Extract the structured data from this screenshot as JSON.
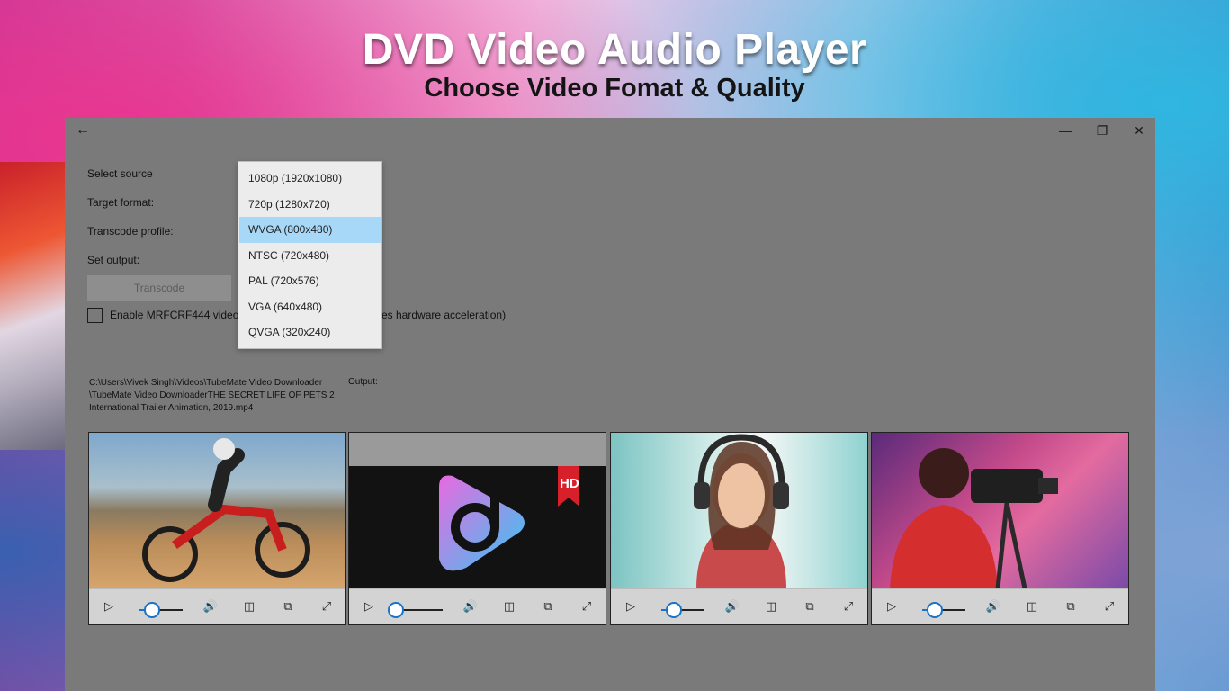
{
  "promo": {
    "title": "DVD Video Audio Player",
    "subtitle": "Choose Video Fomat & Quality"
  },
  "window": {
    "back_icon": "←",
    "minimize_icon": "—",
    "restore_icon": "❐",
    "close_icon": "✕"
  },
  "form": {
    "select_source_label": "Select source",
    "target_format_label": "Target format:",
    "transcode_profile_label": "Transcode profile:",
    "set_output_label": "Set output:",
    "transcode_button": "Transcode",
    "checkbox_label_start": "Enable MRFCRF444 video",
    "checkbox_label_end": "es hardware acceleration)",
    "source_path_line1": "C:\\Users\\Vivek Singh\\Videos\\TubeMate Video Downloader",
    "source_path_line2": "\\TubeMate Video DownloaderTHE SECRET LIFE OF PETS 2",
    "source_path_line3": "International Trailer Animation, 2019.mp4",
    "output_label": "Output:"
  },
  "dropdown": {
    "selected_index": 2,
    "options": [
      "1080p (1920x1080)",
      "720p (1280x720)",
      "WVGA (800x480)",
      "NTSC (720x480)",
      "PAL (720x576)",
      "VGA (640x480)",
      "QVGA (320x240)"
    ]
  },
  "players": [
    {
      "thumbnail": "motocross-rider",
      "seek_fraction": 0.3
    },
    {
      "thumbnail": "music-app-logo",
      "badge": "HD",
      "seek_fraction": 0.0
    },
    {
      "thumbnail": "woman-headphones",
      "seek_fraction": 0.3
    },
    {
      "thumbnail": "camera-operator",
      "seek_fraction": 0.3
    }
  ],
  "player_icons": {
    "play": "▷",
    "volume": "🔊",
    "compact": "◫",
    "cast": "⧉",
    "fullscreen": "⤢"
  },
  "colors": {
    "window_bg": "#7a7a7a",
    "dropdown_selected": "#a7d8f8",
    "seek_accent": "#1a73c8"
  }
}
